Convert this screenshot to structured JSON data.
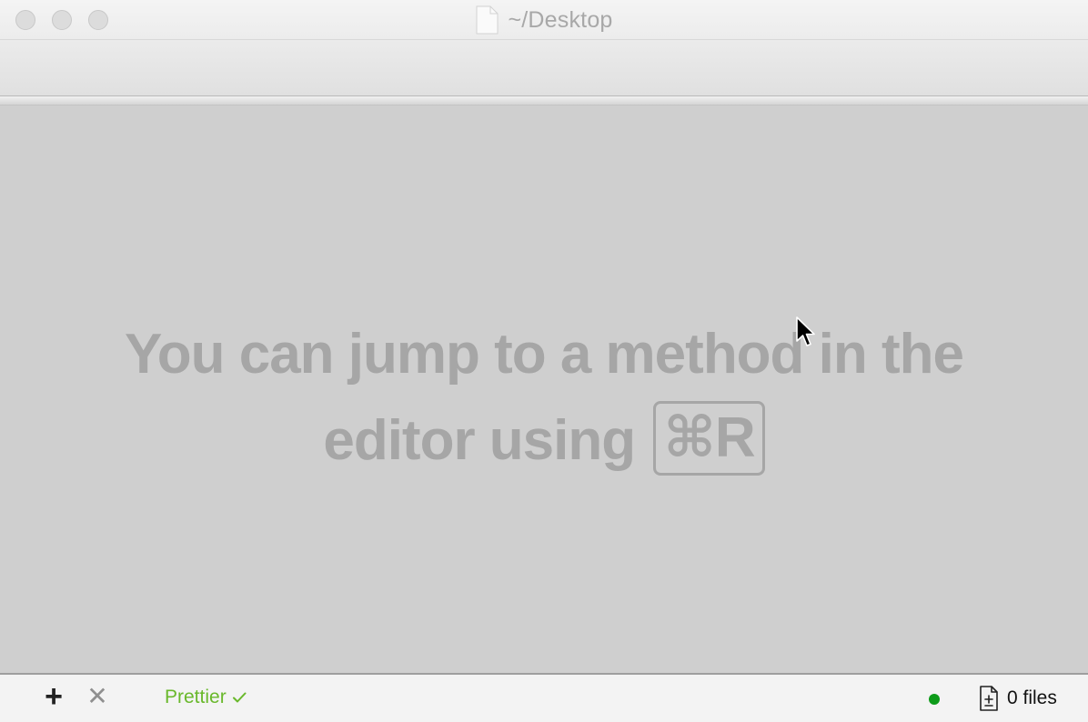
{
  "window": {
    "title": "~/Desktop"
  },
  "main": {
    "hint_line1": "You can jump to a method in the",
    "hint_line2": "editor using",
    "shortcut": "⌘R"
  },
  "statusbar": {
    "add_symbol": "+",
    "close_symbol": "✕",
    "prettier_label": "Prettier",
    "prettier_status_icon": "check-icon",
    "status_dot_color": "#0d9b19",
    "prettier_color": "#69b82b",
    "files_label": "0 files"
  }
}
